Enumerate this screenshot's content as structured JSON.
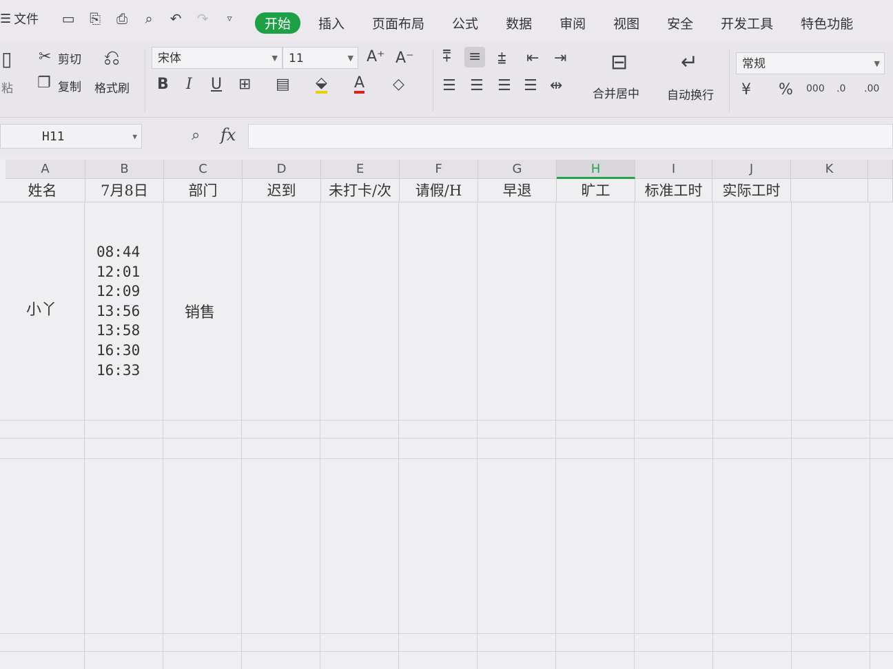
{
  "menu": {
    "file_label": "文件",
    "tabs": [
      "开始",
      "插入",
      "页面布局",
      "公式",
      "数据",
      "审阅",
      "视图",
      "安全",
      "开发工具",
      "特色功能"
    ]
  },
  "ribbon": {
    "paste_label": "粘",
    "cut_label": "剪切",
    "copy_label": "复制",
    "format_painter_label": "格式刷",
    "font_name": "宋体",
    "font_size": "11",
    "merge_center_label": "合并居中",
    "wrap_text_label": "自动换行",
    "number_format": "常规"
  },
  "formula_bar": {
    "name_box": "H11",
    "fx_label": "fx",
    "formula": ""
  },
  "sheet": {
    "columns": [
      "A",
      "B",
      "C",
      "D",
      "E",
      "F",
      "G",
      "H",
      "I",
      "J",
      "K"
    ],
    "selected_column": "H",
    "headers": [
      "姓名",
      "7月8日",
      "部门",
      "迟到",
      "未打卡/次",
      "请假/H",
      "早退",
      "旷工",
      "标准工时",
      "实际工时",
      ""
    ],
    "row": {
      "name": "小丫",
      "times": [
        "08:44",
        "12:01",
        "12:09",
        "13:56",
        "13:58",
        "16:30",
        "16:33"
      ],
      "department": "销售"
    }
  }
}
